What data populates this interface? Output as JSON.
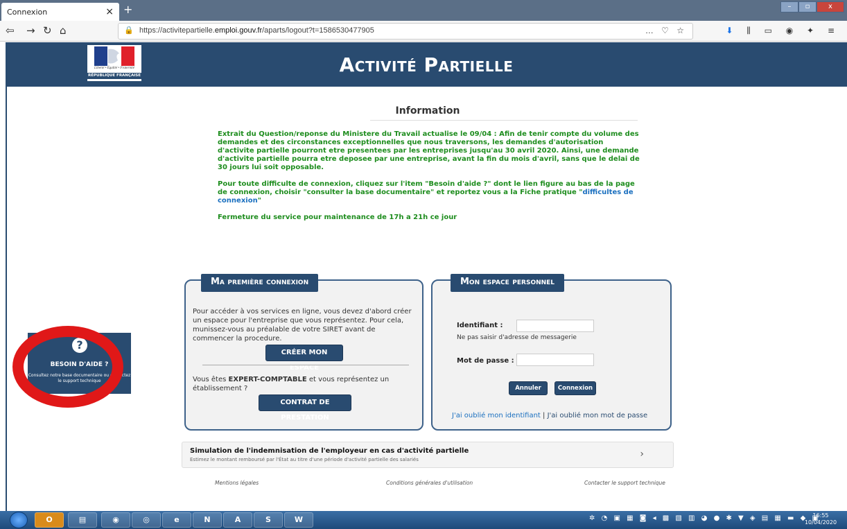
{
  "browser": {
    "tab_title": "Connexion",
    "url_prefix": "https://activitepartielle.",
    "url_domain": "emploi.gouv.fr",
    "url_path": "/aparts/logout?t=1586530477905"
  },
  "header": {
    "title": "Activité Partielle",
    "logo_line1": "Liberté • Égalité • Fraternité",
    "logo_line2": "RÉPUBLIQUE FRANÇAISE"
  },
  "info": {
    "title": "Information",
    "para1": "Extrait du Question/reponse du Ministere du Travail actualise le 09/04 : Afin de tenir compte du volume des demandes et des circonstances exceptionnelles que nous traversons, les demandes d'autorisation d'activite partielle pourront etre presentees par les entreprises jusqu'au 30 avril 2020. Ainsi, une demande d'activite partielle pourra etre deposee par une entreprise, avant la fin du mois d'avril, sans que le delai de 30 jours lui soit opposable.",
    "para2_before": "Pour toute difficulte de connexion, cliquez sur l'item \"Besoin d'aide ?\" dont le lien figure au bas de la page de connexion, choisir \"consulter la base documentaire\" et reportez vous a la Fiche pratique \"",
    "para2_link": "difficultes de connexion",
    "para2_after": "\"",
    "para3": "Fermeture du service pour maintenance de 17h a 21h ce jour"
  },
  "first_login": {
    "title": "Ma première connexion",
    "text": "Pour accéder à vos services en ligne, vous devez d'abord créer un espace pour l'entreprise que vous représentez. Pour cela, munissez-vous au préalable de votre SIRET avant de commencer la procedure.",
    "create_button": "CRÉER MON ESPACE",
    "expert_before": "Vous êtes ",
    "expert_bold": "EXPERT-COMPTABLE",
    "expert_after": " et vous représentez un établissement ?",
    "contract_button": "CONTRAT DE PRESTATION"
  },
  "personal_space": {
    "title": "Mon espace personnel",
    "id_label": "Identifiant :",
    "id_hint": "Ne pas saisir d'adresse de messagerie",
    "password_label": "Mot de passe :",
    "cancel_button": "Annuler",
    "login_button": "Connexion",
    "forgot_id": "J'ai oublié mon identifiant",
    "separator": "|",
    "forgot_password": "J'ai oublié mon mot de passe"
  },
  "help": {
    "icon": "?",
    "title": "BESOIN D'AIDE ?",
    "text": "Consultez notre base documentaire ou contactez le support technique"
  },
  "simulation": {
    "title": "Simulation de l'indemnisation de l'employeur en cas d'activité partielle",
    "subtitle": "Estimez le montant remboursé par l'État au titre d'une période d'activité partielle des salariés",
    "chevron": "›"
  },
  "footer": {
    "legal": "Mentions légales",
    "terms": "Conditions générales d'utilisation",
    "support": "Contacter le support technique"
  },
  "taskbar": {
    "time": "16:55",
    "date": "10/04/2020"
  },
  "colors": {
    "brand": "#294b70",
    "info_text": "#1e8d1e",
    "link": "#1a6fbf",
    "help_ring": "#e01818"
  }
}
